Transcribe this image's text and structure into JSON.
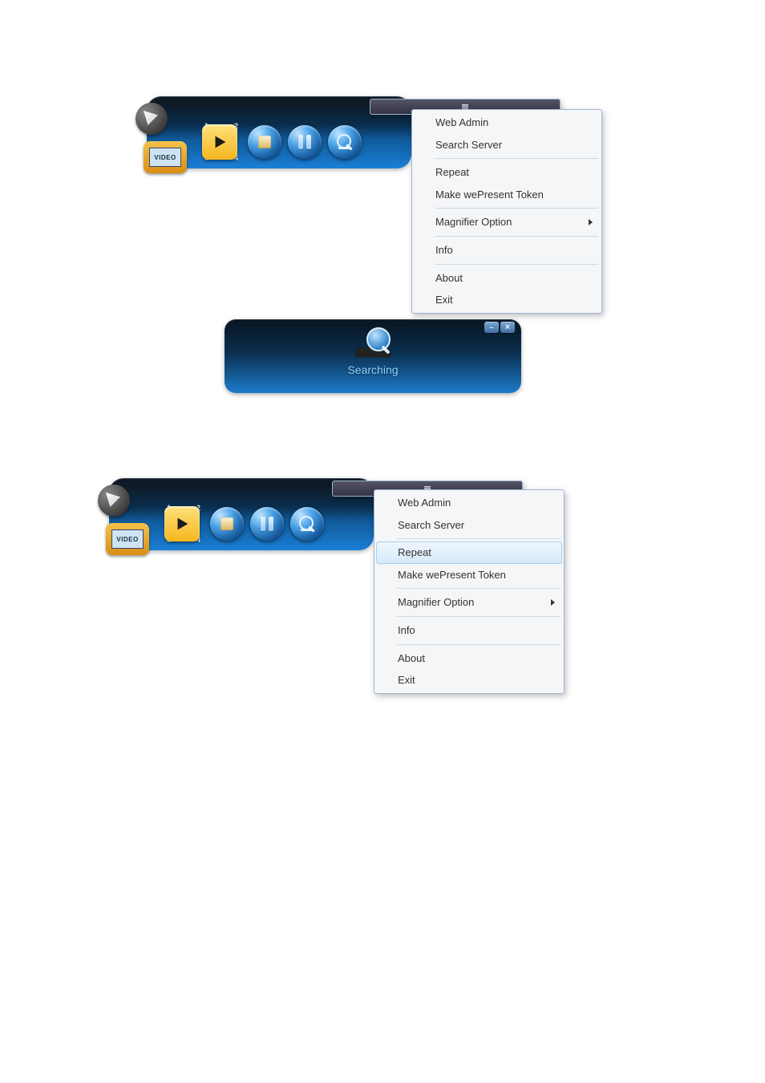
{
  "bar": {
    "video_tab_label": "VIDEO",
    "quadrants": {
      "q1": "1",
      "q2": "2",
      "q3": "3",
      "q4": "4"
    }
  },
  "menu": {
    "items": [
      {
        "label": "Web Admin",
        "submenu": false
      },
      {
        "label": "Search Server",
        "submenu": false
      },
      {
        "label": "Repeat",
        "submenu": false
      },
      {
        "label": "Make wePresent Token",
        "submenu": false
      },
      {
        "label": "Magnifier Option",
        "submenu": true
      },
      {
        "label": "Info",
        "submenu": false
      },
      {
        "label": "About",
        "submenu": false
      },
      {
        "label": "Exit",
        "submenu": false
      }
    ]
  },
  "search": {
    "label": "Searching"
  }
}
